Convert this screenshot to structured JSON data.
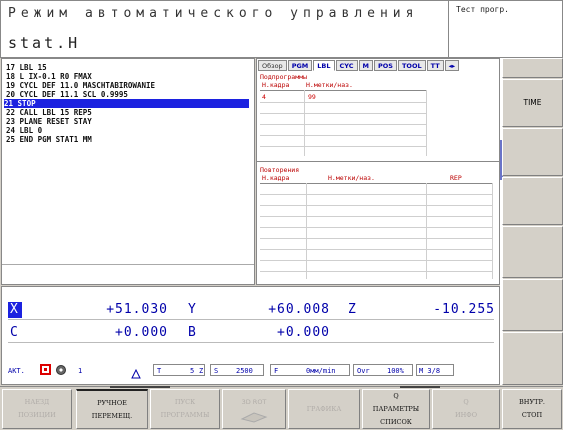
{
  "header": {
    "mode_title": "Режим автоматического управления",
    "program_name": "stat.H",
    "test_title": "Тест прогр."
  },
  "program": {
    "lines": [
      "17 LBL 15",
      "18 L IX-0.1 R0 FMAX",
      "19 CYCL DEF 11.0 MASCHTABIROWANIE",
      "20 CYCL DEF 11.1 SCL 0.9995",
      "21 STOP",
      "22 CALL LBL 15 REP5",
      "23 PLANE RESET STAY",
      "24 LBL 0",
      "25 END PGM STAT1 MM"
    ],
    "selected_index": 4
  },
  "tabs": [
    {
      "label": "Обзор"
    },
    {
      "label": "PGM"
    },
    {
      "label": "LBL"
    },
    {
      "label": "CYC"
    },
    {
      "label": "M"
    },
    {
      "label": "POS"
    },
    {
      "label": "TOOL"
    },
    {
      "label": "TT"
    },
    {
      "label": "◂▸"
    }
  ],
  "active_tab": "LBL",
  "subprograms": {
    "title": "Подпрограммы",
    "col_block": "Н.кадра",
    "col_label": "Н.метки/наз.",
    "rows": [
      {
        "block": "4",
        "label": "99"
      }
    ]
  },
  "repeats": {
    "title": "Повторения",
    "col_block": "Н.кадра",
    "col_label": "Н.метки/наз.",
    "col_rep": "REP"
  },
  "right_softkeys": {
    "time_label": "TIME"
  },
  "positions": {
    "axes": [
      {
        "axis": "X",
        "value": "+51.030"
      },
      {
        "axis": "Y",
        "value": "+60.008"
      },
      {
        "axis": "Z",
        "value": "-10.255"
      },
      {
        "axis": "C",
        "value": "+0.000"
      },
      {
        "axis": "B",
        "value": "+0.000"
      }
    ]
  },
  "status": {
    "mode": "АКТ.",
    "tool_num": "1",
    "t_label": "T",
    "spindle_num": "5",
    "z_label": "Z",
    "s_label": "S",
    "s_value": "2500",
    "f_label": "F",
    "f_value": "0мм/min",
    "ovr_label": "Ovr",
    "ovr_value": "100%",
    "m_value": "M 3/8"
  },
  "softkeys": [
    {
      "line1": "НАЕЗД",
      "line2": "ПОЗИЦИИ",
      "enabled": false
    },
    {
      "line1": "РУЧНОЕ",
      "line2": "ПЕРЕМЕЩ.",
      "enabled": true
    },
    {
      "line1": "ПУСК",
      "line2": "ПРОГРАММЫ",
      "enabled": false
    },
    {
      "line1": "3D ROT",
      "line2": "",
      "enabled": false
    },
    {
      "line1": "ГРАФИКА",
      "line2": "",
      "enabled": false
    },
    {
      "line1": "Q",
      "line2": "ПАРАМЕТРЫ",
      "line3": "СПИСОК",
      "enabled": true
    },
    {
      "line1": "Q",
      "line2": "ИНФО",
      "enabled": false
    },
    {
      "line1": "ВНУТР.",
      "line2": "СТОП",
      "enabled": true
    }
  ],
  "colors": {
    "selection": "#1c22e0",
    "axis_text": "#0000aa",
    "table_header": "#b00000"
  }
}
